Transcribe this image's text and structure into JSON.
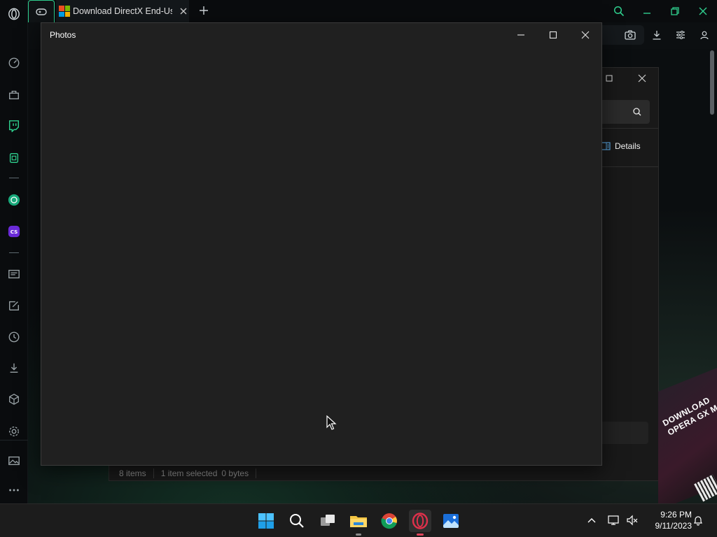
{
  "browser": {
    "tab": {
      "title": "Download DirectX End-User Runtime"
    },
    "accent_color": "#2fcf8e"
  },
  "sidebar": {
    "items": [
      {
        "name": "opera-logo-icon"
      },
      {
        "name": "speed-dial-icon"
      },
      {
        "name": "shopping-icon"
      },
      {
        "name": "twitch-icon"
      },
      {
        "name": "gx-control-icon"
      },
      {
        "name": "chatgpt-icon"
      },
      {
        "name": "chatsonic-icon"
      },
      {
        "name": "news-icon"
      },
      {
        "name": "pinboard-icon"
      },
      {
        "name": "history-icon"
      },
      {
        "name": "downloads-icon"
      },
      {
        "name": "extensions-icon"
      },
      {
        "name": "settings-icon"
      },
      {
        "name": "gallery-icon"
      },
      {
        "name": "more-icon"
      }
    ]
  },
  "explorer": {
    "details_label": "Details",
    "status": {
      "items": "8 items",
      "selected": "1 item selected",
      "size": "0 bytes"
    }
  },
  "promo": {
    "line1": "DOWNLOAD",
    "line2": "OPERA GX MO"
  },
  "photos": {
    "title": "Photos"
  },
  "taskbar": {
    "time": "9:26 PM",
    "date": "9/11/2023"
  }
}
